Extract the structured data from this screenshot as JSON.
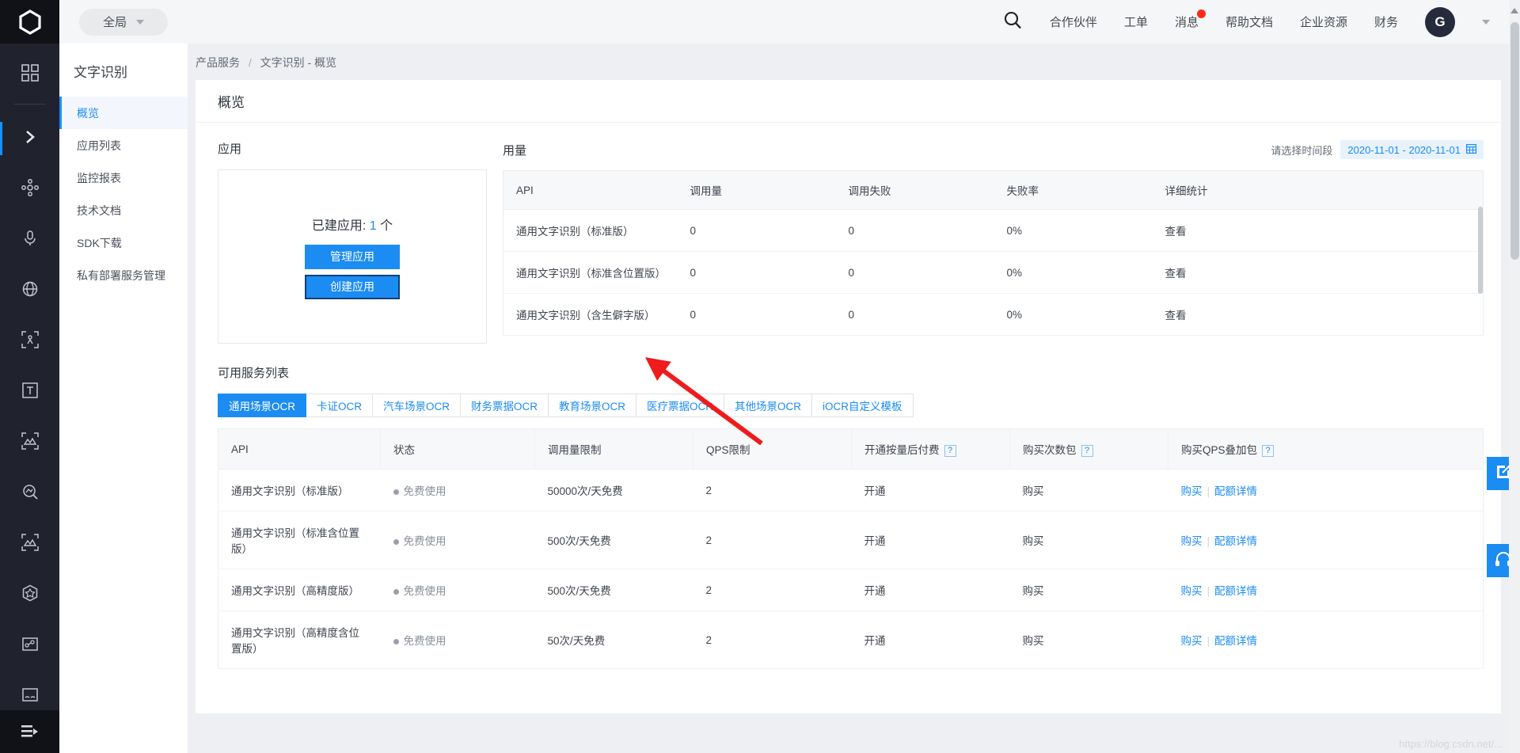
{
  "topbar": {
    "global_label": "全局",
    "search_icon": "search-icon",
    "links": [
      {
        "label": "合作伙伴",
        "badge": false
      },
      {
        "label": "工单",
        "badge": false
      },
      {
        "label": "消息",
        "badge": true
      },
      {
        "label": "帮助文档",
        "badge": false
      },
      {
        "label": "企业资源",
        "badge": false
      },
      {
        "label": "财务",
        "badge": false
      }
    ],
    "avatar_initial": "G"
  },
  "icon_rail": {
    "logo": "cube-logo-icon",
    "items": [
      {
        "icon": "apps-grid-icon",
        "active": false
      },
      {
        "icon": "chevron-right-icon",
        "active": true
      },
      {
        "icon": "nodes-network-icon",
        "active": false
      },
      {
        "icon": "microphone-icon",
        "active": false
      },
      {
        "icon": "globe-icon",
        "active": false
      },
      {
        "icon": "body-analysis-icon",
        "active": false
      },
      {
        "icon": "text-box-icon",
        "active": false
      },
      {
        "icon": "image-scan-icon",
        "active": false
      },
      {
        "icon": "image-search-icon",
        "active": false
      },
      {
        "icon": "image-recognize-icon",
        "active": false
      },
      {
        "icon": "cube-shield-icon",
        "active": false
      },
      {
        "icon": "image-points-icon",
        "active": false
      },
      {
        "icon": "image-face-icon",
        "active": false
      }
    ],
    "bottom_icon": "collapse-sidebar-icon"
  },
  "subnav": {
    "title": "文字识别",
    "items": [
      {
        "label": "概览",
        "active": true
      },
      {
        "label": "应用列表",
        "active": false
      },
      {
        "label": "监控报表",
        "active": false
      },
      {
        "label": "技术文档",
        "active": false
      },
      {
        "label": "SDK下载",
        "active": false
      },
      {
        "label": "私有部署服务管理",
        "active": false
      }
    ]
  },
  "breadcrumb": {
    "root": "产品服务",
    "separator": "/",
    "current": "文字识别 - 概览"
  },
  "panel": {
    "title": "概览"
  },
  "application": {
    "section_title": "应用",
    "count_label": "已建应用:",
    "count_value": "1",
    "count_unit": "个",
    "manage_button": "管理应用",
    "create_button": "创建应用"
  },
  "usage": {
    "section_title": "用量",
    "date_label": "请选择时间段",
    "date_value": "2020-11-01 - 2020-11-01",
    "calendar_icon": "calendar-icon",
    "columns": [
      "API",
      "调用量",
      "调用失败",
      "失败率",
      "详细统计"
    ],
    "rows": [
      {
        "api": "通用文字识别（标准版）",
        "calls": "0",
        "failures": "0",
        "fail_rate": "0%",
        "detail": "查看"
      },
      {
        "api": "通用文字识别（标准含位置版）",
        "calls": "0",
        "failures": "0",
        "fail_rate": "0%",
        "detail": "查看"
      },
      {
        "api": "通用文字识别（含生僻字版）",
        "calls": "0",
        "failures": "0",
        "fail_rate": "0%",
        "detail": "查看"
      }
    ]
  },
  "services": {
    "section_title": "可用服务列表",
    "tabs": [
      {
        "label": "通用场景OCR",
        "active": true
      },
      {
        "label": "卡证OCR",
        "active": false
      },
      {
        "label": "汽车场景OCR",
        "active": false
      },
      {
        "label": "财务票据OCR",
        "active": false
      },
      {
        "label": "教育场景OCR",
        "active": false
      },
      {
        "label": "医疗票据OCR",
        "active": false
      },
      {
        "label": "其他场景OCR",
        "active": false
      },
      {
        "label": "iOCR自定义模板",
        "active": false
      }
    ],
    "columns": [
      {
        "label": "API",
        "help": false
      },
      {
        "label": "状态",
        "help": false
      },
      {
        "label": "调用量限制",
        "help": false
      },
      {
        "label": "QPS限制",
        "help": false
      },
      {
        "label": "开通按量后付费",
        "help": true
      },
      {
        "label": "购买次数包",
        "help": true
      },
      {
        "label": "购买QPS叠加包",
        "help": true
      }
    ],
    "help_glyph": "?",
    "rows": [
      {
        "api": "通用文字识别（标准版）",
        "status": "免费使用",
        "quota": "50000次/天免费",
        "qps": "2",
        "postpaid": "开通",
        "buy_package": "购买",
        "buy_qps": "购买",
        "quota_detail": "配额详情"
      },
      {
        "api": "通用文字识别（标准含位置版）",
        "status": "免费使用",
        "quota": "500次/天免费",
        "qps": "2",
        "postpaid": "开通",
        "buy_package": "购买",
        "buy_qps": "购买",
        "quota_detail": "配额详情"
      },
      {
        "api": "通用文字识别（高精度版）",
        "status": "免费使用",
        "quota": "500次/天免费",
        "qps": "2",
        "postpaid": "开通",
        "buy_package": "购买",
        "buy_qps": "购买",
        "quota_detail": "配额详情"
      },
      {
        "api": "通用文字识别（高精度含位置版）",
        "status": "免费使用",
        "quota": "50次/天免费",
        "qps": "2",
        "postpaid": "开通",
        "buy_package": "购买",
        "buy_qps": "购买",
        "quota_detail": "配额详情"
      }
    ]
  },
  "float_buttons": [
    {
      "icon": "feedback-edit-icon"
    },
    {
      "icon": "headset-support-icon"
    }
  ],
  "watermark": "https://blog.csdn.net/...",
  "colors": {
    "accent": "#1b8cf2",
    "rail_bg": "#20222e",
    "page_bg": "#edeff2",
    "badge_red": "#fa2c19",
    "annotation_red": "#ee1c1c"
  }
}
